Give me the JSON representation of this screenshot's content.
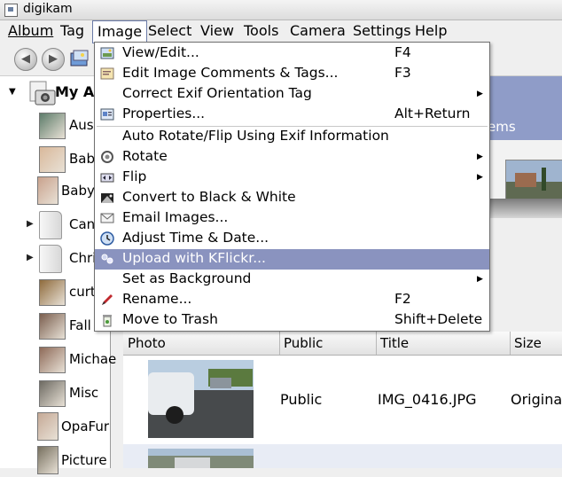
{
  "window": {
    "title": "digikam"
  },
  "menubar": [
    "Album",
    "Tag",
    "Image",
    "Select",
    "View",
    "Tools",
    "Camera",
    "Settings",
    "Help"
  ],
  "menubar_open": "Image",
  "toolbar": {
    "back_icon": "back-arrow-icon",
    "forward_icon": "forward-arrow-icon",
    "tool_icon": "image-tool-icon"
  },
  "sidebar": {
    "root_label": "My Al",
    "albums": [
      {
        "name": "Aust",
        "kind": "photo",
        "expandable": false
      },
      {
        "name": "Bab",
        "kind": "photo",
        "expandable": false
      },
      {
        "name": "Baby",
        "kind": "photo",
        "expandable": false
      },
      {
        "name": "Can",
        "kind": "folder",
        "expandable": true
      },
      {
        "name": "Chri",
        "kind": "folder",
        "expandable": true
      },
      {
        "name": "curt",
        "kind": "photo",
        "expandable": false
      },
      {
        "name": "Fall",
        "kind": "photo",
        "expandable": false
      },
      {
        "name": "Michae",
        "kind": "photo",
        "expandable": false
      },
      {
        "name": "Misc",
        "kind": "photo",
        "expandable": false
      },
      {
        "name": "OpaFur",
        "kind": "photo",
        "expandable": false
      },
      {
        "name": "Picture",
        "kind": "photo",
        "expandable": false
      }
    ]
  },
  "banner_text": "ems",
  "image_menu": {
    "items": [
      {
        "label": "View/Edit...",
        "shortcut": "F4",
        "icon": "view-edit-icon",
        "submenu": false,
        "highlighted": false
      },
      {
        "label": "Edit Image Comments & Tags...",
        "shortcut": "F3",
        "icon": "comments-tags-icon",
        "submenu": false,
        "highlighted": false
      },
      {
        "label": "Correct Exif Orientation Tag",
        "shortcut": "",
        "icon": "",
        "submenu": true,
        "highlighted": false
      },
      {
        "label": "Properties...",
        "shortcut": "Alt+Return",
        "icon": "properties-icon",
        "submenu": false,
        "highlighted": false
      },
      {
        "label": "Auto Rotate/Flip Using Exif Information",
        "shortcut": "",
        "icon": "",
        "submenu": false,
        "highlighted": false
      },
      {
        "label": "Rotate",
        "shortcut": "",
        "icon": "rotate-icon",
        "submenu": true,
        "highlighted": false
      },
      {
        "label": "Flip",
        "shortcut": "",
        "icon": "flip-icon",
        "submenu": true,
        "highlighted": false
      },
      {
        "label": "Convert to Black & White",
        "shortcut": "",
        "icon": "black-white-icon",
        "submenu": false,
        "highlighted": false
      },
      {
        "label": "Email Images...",
        "shortcut": "",
        "icon": "email-icon",
        "submenu": false,
        "highlighted": false
      },
      {
        "label": "Adjust Time & Date...",
        "shortcut": "",
        "icon": "clock-icon",
        "submenu": false,
        "highlighted": false
      },
      {
        "label": "Upload with KFlickr...",
        "shortcut": "",
        "icon": "kflickr-icon",
        "submenu": false,
        "highlighted": true
      },
      {
        "label": "Set as Background",
        "shortcut": "",
        "icon": "",
        "submenu": true,
        "highlighted": false
      },
      {
        "label": "Rename...",
        "shortcut": "F2",
        "icon": "rename-pen-icon",
        "submenu": false,
        "highlighted": false
      },
      {
        "label": "Move to Trash",
        "shortcut": "Shift+Delete",
        "icon": "trash-icon",
        "submenu": false,
        "highlighted": false
      }
    ]
  },
  "upload_table": {
    "columns": [
      "Photo",
      "Public",
      "Title",
      "Size"
    ],
    "rows": [
      {
        "public": "Public",
        "title": "IMG_0416.JPG",
        "size": "Original"
      }
    ]
  },
  "colors": {
    "highlight": "#8a93bf",
    "banner": "#8f9cc8"
  }
}
